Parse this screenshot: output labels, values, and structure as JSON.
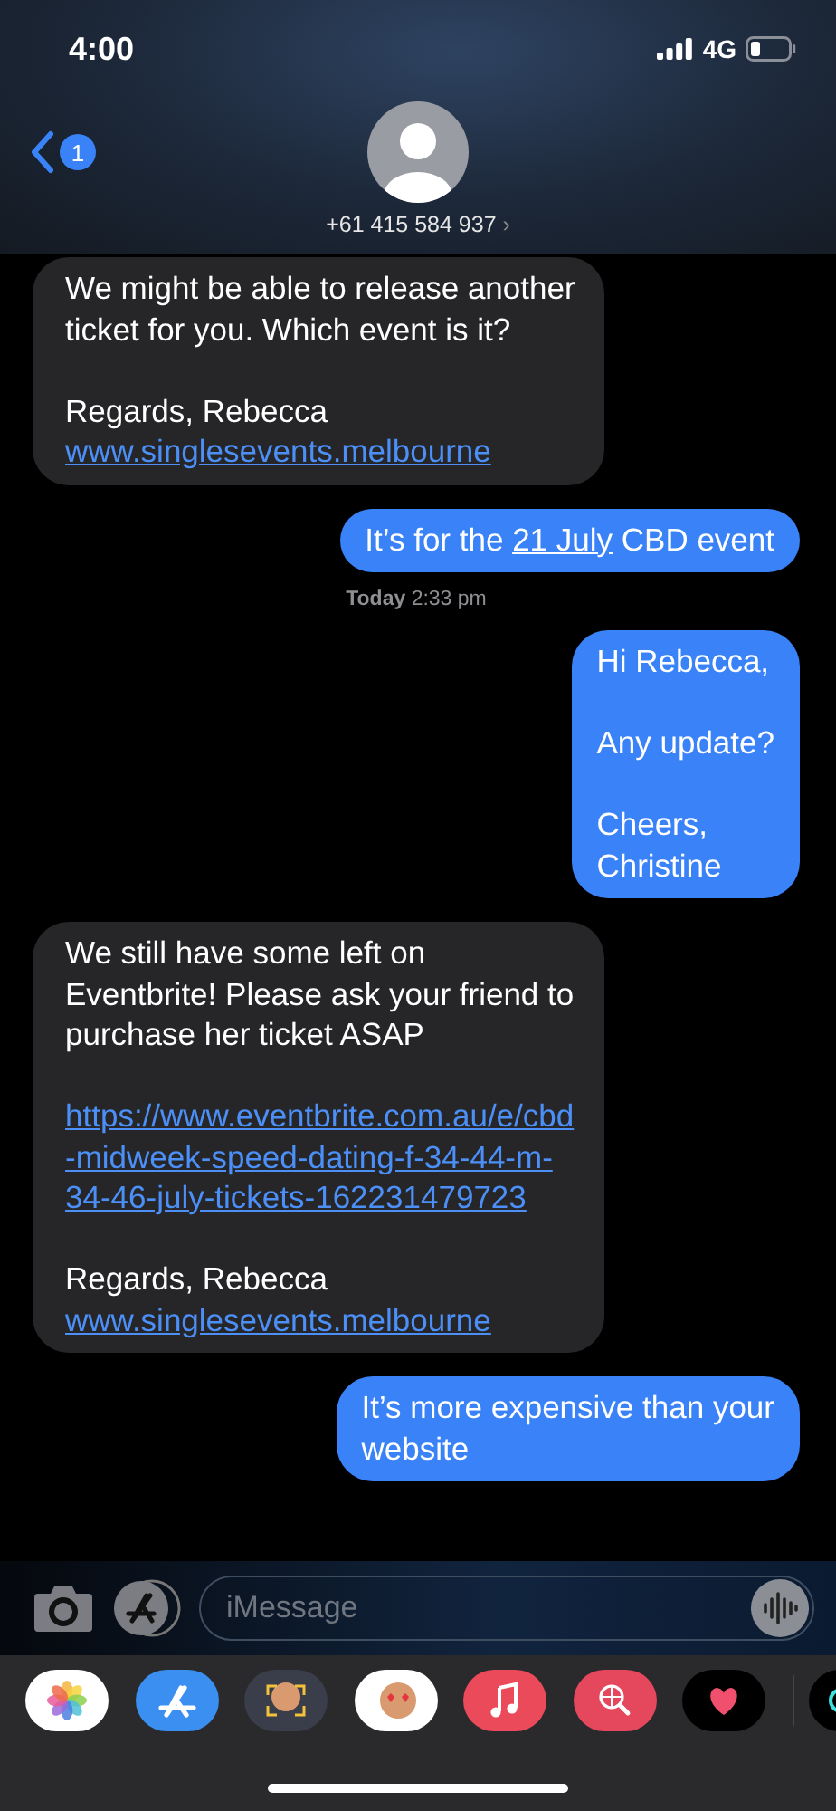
{
  "status_bar": {
    "time": "4:00",
    "network": "4G"
  },
  "header": {
    "back_badge": "1",
    "contact": "+61 415 584 937",
    "chevron": "›"
  },
  "messages": [
    {
      "kind": "incoming",
      "paragraphs": [
        [
          [
            {
              "kind": "text",
              "text": "We might be able to release another"
            }
          ],
          [
            {
              "kind": "text",
              "text": "ticket for you. Which event is it?"
            }
          ]
        ],
        [
          [
            {
              "kind": "text",
              "text": "Regards, Rebecca"
            }
          ],
          [
            {
              "kind": "link",
              "text": "www.singlesevents.melbourne"
            }
          ]
        ]
      ]
    },
    {
      "kind": "outgoing",
      "paragraphs": [
        [
          [
            {
              "kind": "text",
              "text": "It’s for the "
            },
            {
              "kind": "date",
              "text": "21 July"
            },
            {
              "kind": "text",
              "text": " CBD event"
            }
          ]
        ]
      ]
    },
    {
      "kind": "timestamp",
      "text": "**Today** 2:33 pm"
    },
    {
      "kind": "outgoing",
      "paragraphs": [
        [
          [
            {
              "kind": "text",
              "text": "Hi Rebecca,"
            }
          ]
        ],
        [
          [
            {
              "kind": "text",
              "text": "Any update?"
            }
          ]
        ],
        [
          [
            {
              "kind": "text",
              "text": "Cheers,"
            }
          ],
          [
            {
              "kind": "text",
              "text": "Christine"
            }
          ]
        ]
      ]
    },
    {
      "kind": "incoming",
      "paragraphs": [
        [
          [
            {
              "kind": "text",
              "text": "We still have some left on"
            }
          ],
          [
            {
              "kind": "text",
              "text": "Eventbrite! Please ask your friend to"
            }
          ],
          [
            {
              "kind": "text",
              "text": "purchase her ticket ASAP"
            }
          ]
        ],
        [
          [
            {
              "kind": "link",
              "text": "https://www.eventbrite.com.au/e/cbd-midweek-speed-dating-f-34-44-m-34-46-july-tickets-162231479723"
            }
          ]
        ],
        [
          [
            {
              "kind": "text",
              "text": "Regards, Rebecca"
            }
          ],
          [
            {
              "kind": "link",
              "text": "www.singlesevents.melbourne"
            }
          ]
        ]
      ]
    },
    {
      "kind": "outgoing",
      "paragraphs": [
        [
          [
            {
              "kind": "text",
              "text": "It’s more expensive than your"
            }
          ],
          [
            {
              "kind": "text",
              "text": "website"
            }
          ]
        ]
      ]
    }
  ],
  "composer": {
    "placeholder": "iMessage"
  },
  "app_drawer": [
    {
      "kind": "photos"
    },
    {
      "kind": "appstore"
    },
    {
      "kind": "memoji-camera"
    },
    {
      "kind": "memoji"
    },
    {
      "kind": "music"
    },
    {
      "kind": "search"
    },
    {
      "kind": "heart"
    },
    {
      "kind": "cut"
    }
  ]
}
